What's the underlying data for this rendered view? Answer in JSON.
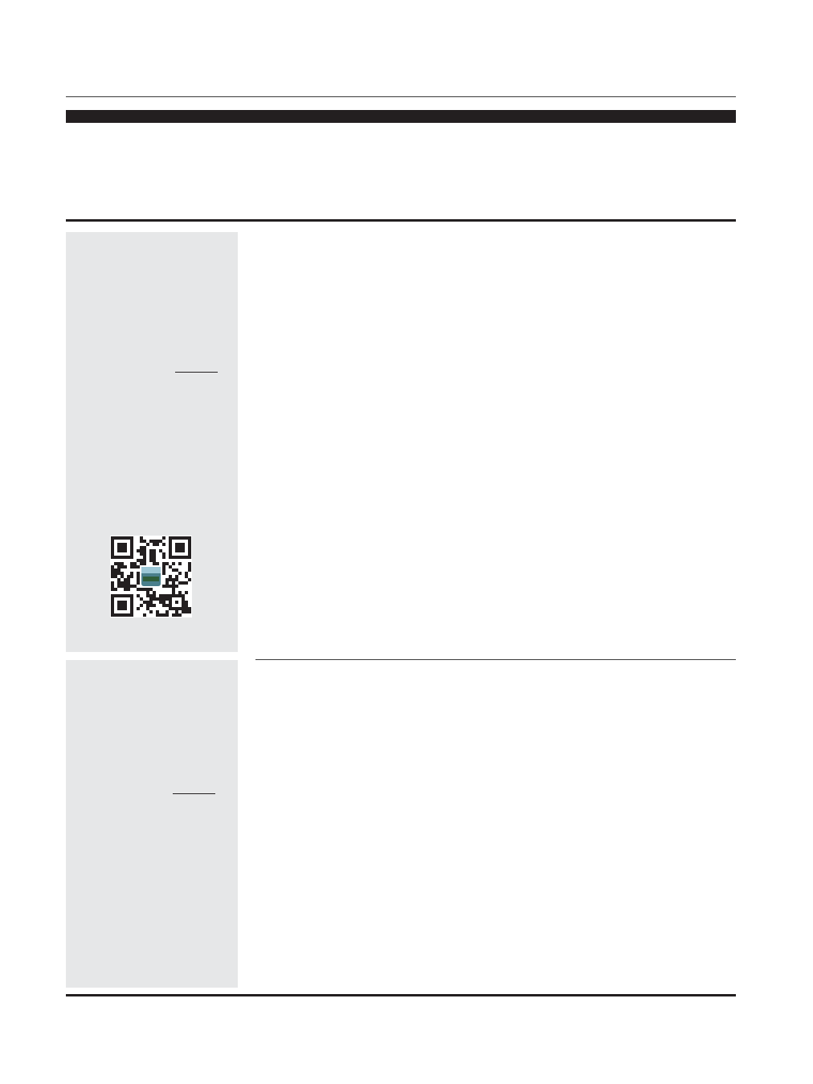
{
  "page": {
    "colors": {
      "rule": "#231f20",
      "sidebar": "#e6e7e8",
      "qr_center_photo": "#4a7f8c"
    }
  },
  "sidebar_1": {
    "icon": "qr-code-icon"
  },
  "sidebar_2": {}
}
